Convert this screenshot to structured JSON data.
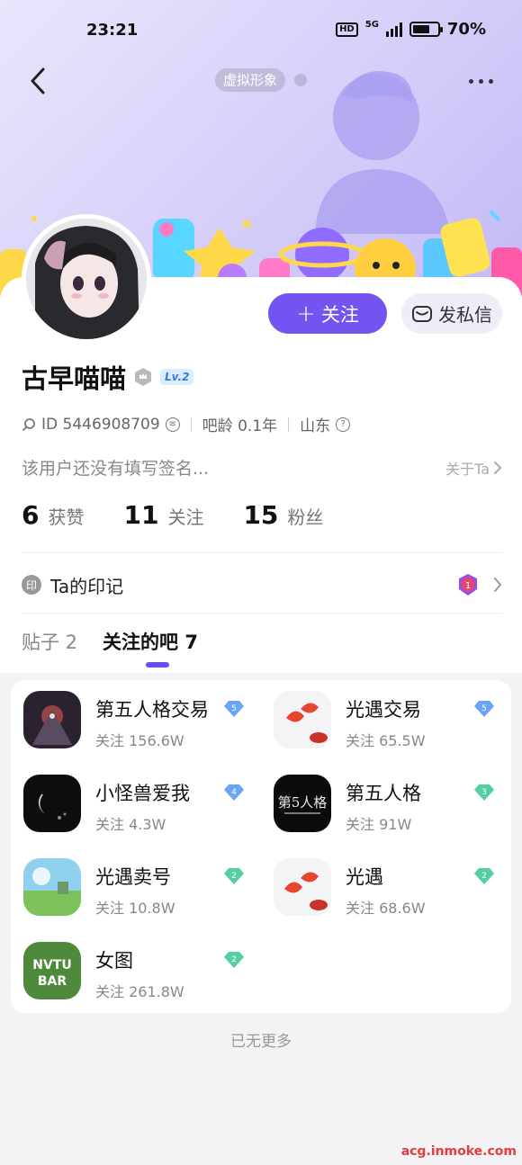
{
  "status_bar": {
    "time": "23:21",
    "hd": "HD",
    "network": "5G",
    "battery": "70%",
    "battery_level": 0.7
  },
  "header": {
    "virtual_label": "虚拟形象"
  },
  "profile": {
    "follow_label": "关注",
    "message_label": "发私信",
    "username": "古早喵喵",
    "level": "Lv.2",
    "user_id": "ID 5446908709",
    "age": "吧龄 0.1年",
    "location": "山东",
    "signature": "该用户还没有填写签名...",
    "about": "关于Ta",
    "stats": [
      {
        "num": "6",
        "label": "获赞"
      },
      {
        "num": "11",
        "label": "关注"
      },
      {
        "num": "15",
        "label": "粉丝"
      }
    ],
    "seal_icon": "印",
    "seal_label": "Ta的印记",
    "seal_badge": "1"
  },
  "tabs": [
    {
      "label": "贴子 2",
      "active": false
    },
    {
      "label": "关注的吧 7",
      "active": true
    }
  ],
  "bars": [
    {
      "name": "第五人格交易",
      "follow": "关注 156.6W",
      "level": "5",
      "color": "#6aa5f5"
    },
    {
      "name": "光遇交易",
      "follow": "关注 65.5W",
      "level": "5",
      "color": "#6aa5f5"
    },
    {
      "name": "小怪兽爱我",
      "follow": "关注 4.3W",
      "level": "4",
      "color": "#6aa5f5"
    },
    {
      "name": "第五人格",
      "follow": "关注 91W",
      "level": "3",
      "color": "#55cfa0"
    },
    {
      "name": "光遇卖号",
      "follow": "关注 10.8W",
      "level": "2",
      "color": "#55cfa0"
    },
    {
      "name": "光遇",
      "follow": "关注 68.6W",
      "level": "2",
      "color": "#55cfa0"
    },
    {
      "name": "女图",
      "follow": "关注 261.8W",
      "level": "2",
      "color": "#55cfa0"
    }
  ],
  "footer": {
    "no_more": "已无更多",
    "watermark": "acg.inmoke.com"
  }
}
